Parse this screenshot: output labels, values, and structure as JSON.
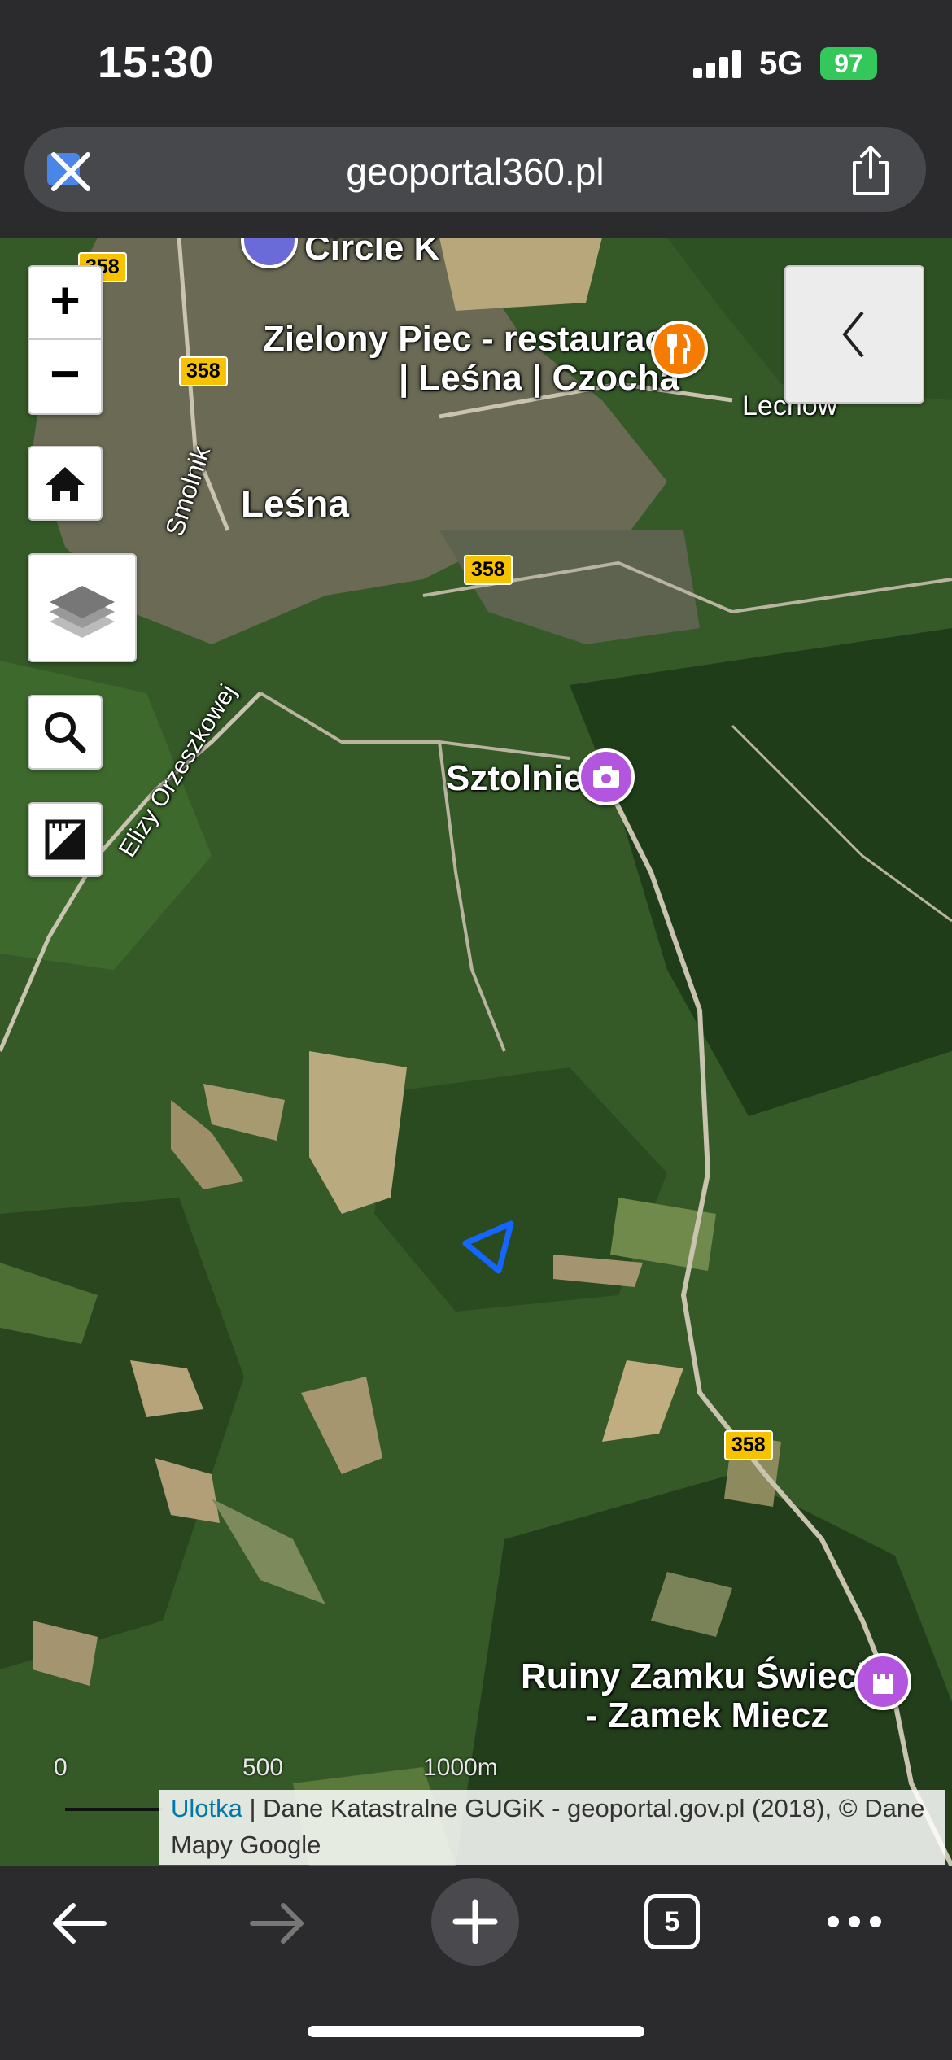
{
  "status_bar": {
    "time": "15:30",
    "network": "5G",
    "battery": "97"
  },
  "browser": {
    "url": "geoportal360.pl",
    "tab_count": "5"
  },
  "map": {
    "zoom_in_label": "+",
    "zoom_out_label": "−",
    "labels": {
      "circle_k": "Circle K",
      "restaurant": "Zielony Piec - restauracja",
      "restaurant_line2": "| Leśna | Czocha",
      "lechow": "Lechów",
      "lesna": "Leśna",
      "smolnik": "Smolnik",
      "street": "Elizy Orzeszkowej",
      "sztolnie": "Sztolnie",
      "ruiny": "Ruiny Zamku Świecie",
      "ruiny_line2": "- Zamek Miecz"
    },
    "road_number": "358",
    "scale": {
      "zero": "0",
      "mid": "500",
      "end": "1000m"
    },
    "attribution": {
      "link": "Ulotka",
      "text": " | Dane Katastralne GUGiK - geoportal.gov.pl (2018), © Dane Mapy Google"
    }
  },
  "colors": {
    "road_shield": "#f7c300",
    "restaurant_pin": "#f57c00",
    "attraction_pin": "#b455e0",
    "parcel_outline": "#1565ff"
  },
  "icons": [
    "close-icon",
    "share-icon",
    "home-icon",
    "layers-icon",
    "search-icon",
    "ruler-icon",
    "chevron-left-icon",
    "back-arrow-icon",
    "forward-arrow-icon",
    "new-tab-plus-icon",
    "tabs-icon",
    "more-icon"
  ]
}
